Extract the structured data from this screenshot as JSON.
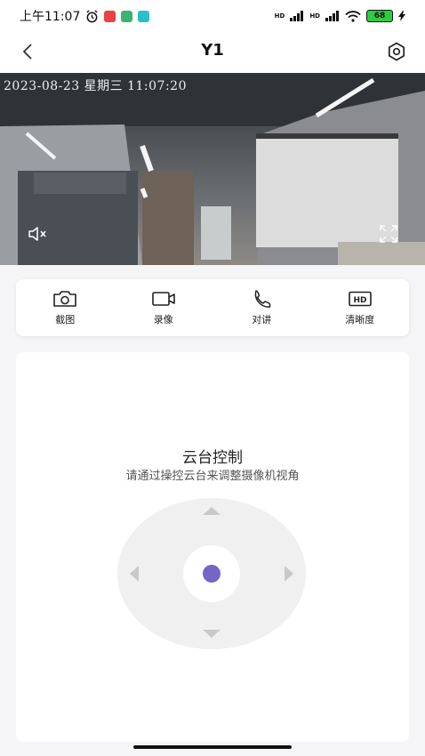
{
  "status_bar": {
    "time": "上午11:07",
    "signal_1": "HD",
    "signal_2": "HD",
    "battery": "68"
  },
  "nav": {
    "title": "Y1"
  },
  "video": {
    "timestamp": "2023-08-23 星期三 11:07:20"
  },
  "toolbar": {
    "items": [
      {
        "label": "截图",
        "icon": "camera-icon"
      },
      {
        "label": "录像",
        "icon": "video-camera-icon"
      },
      {
        "label": "对讲",
        "icon": "phone-icon"
      },
      {
        "label": "清晰度",
        "icon": "hd-icon"
      }
    ]
  },
  "ptz": {
    "title": "云台控制",
    "subtitle": "请通过操控云台来调整摄像机视角"
  },
  "colors": {
    "accent": "#7466c2",
    "battery": "#2ecc40"
  }
}
